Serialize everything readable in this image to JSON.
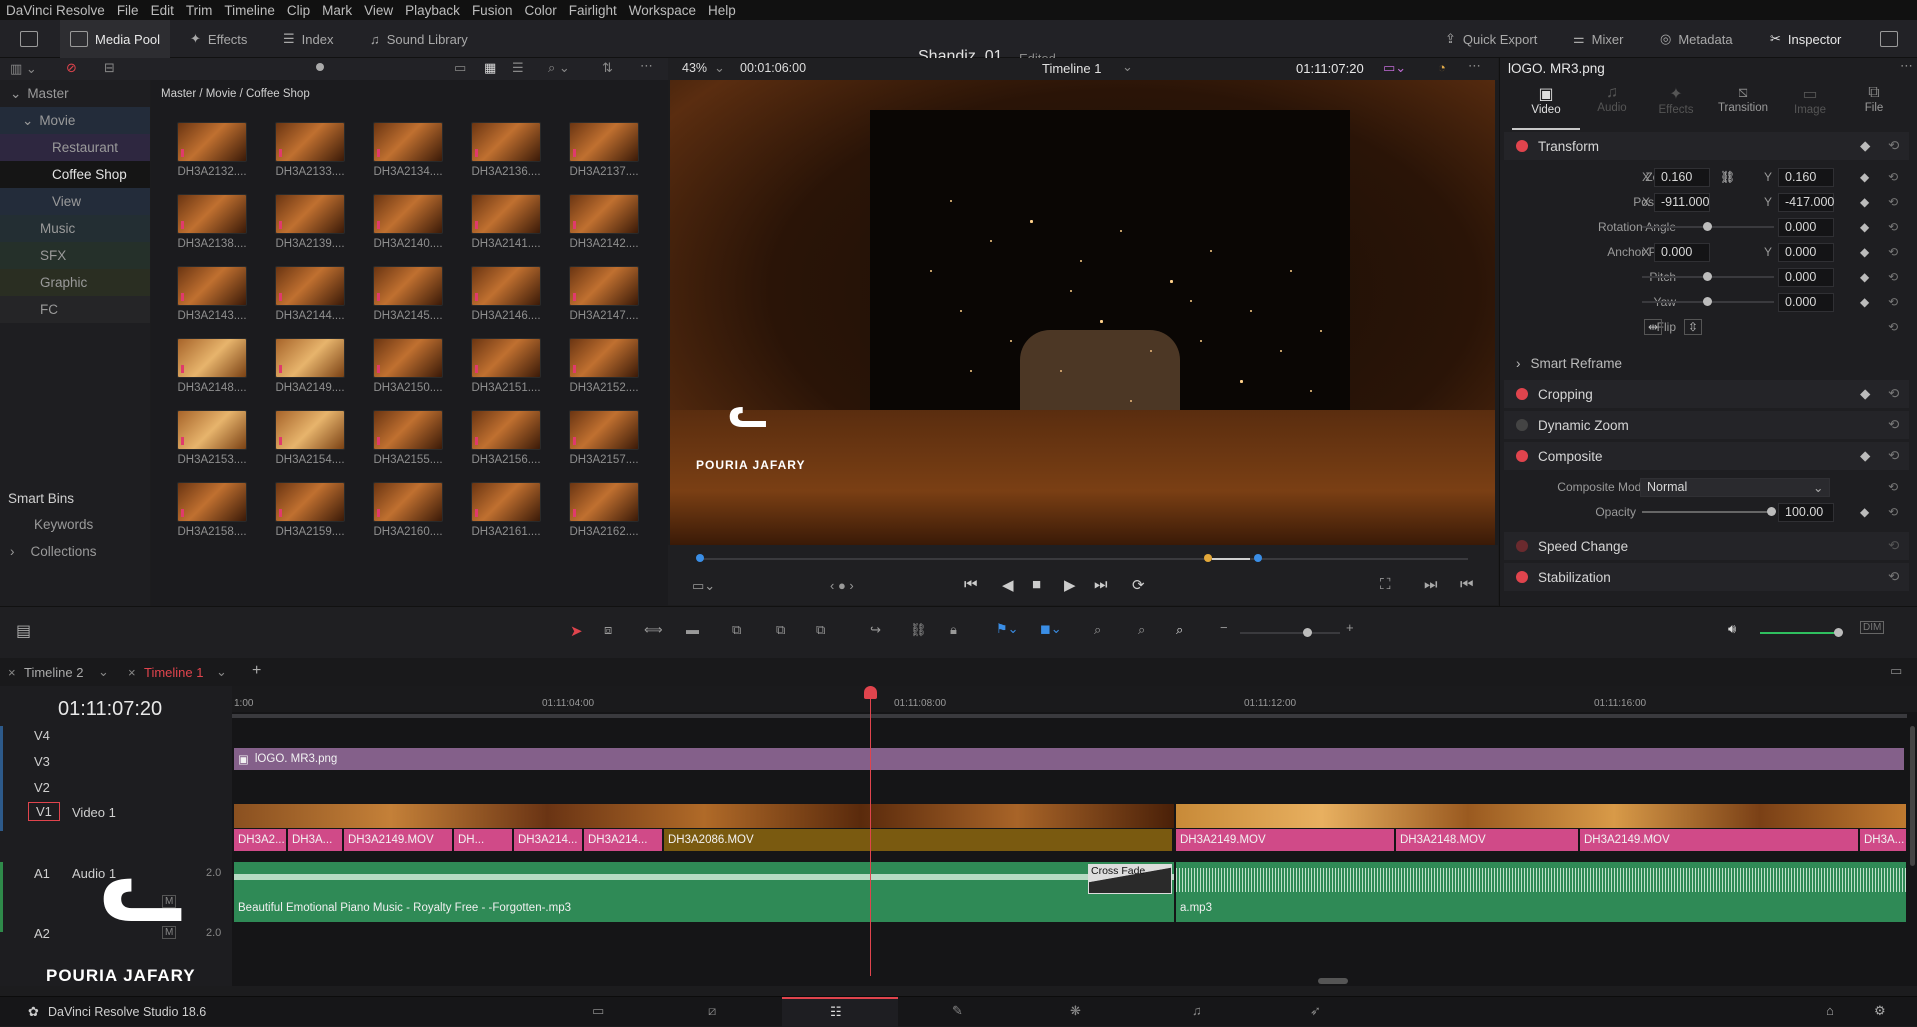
{
  "menu": [
    "DaVinci Resolve",
    "File",
    "Edit",
    "Trim",
    "Timeline",
    "Clip",
    "Mark",
    "View",
    "Playback",
    "Fusion",
    "Color",
    "Fairlight",
    "Workspace",
    "Help"
  ],
  "toolbar": {
    "media_pool": "Media Pool",
    "effects": "Effects",
    "index": "Index",
    "sound_library": "Sound Library",
    "quick_export": "Quick Export",
    "mixer": "Mixer",
    "metadata": "Metadata",
    "inspector": "Inspector"
  },
  "project": {
    "title": "Shandiz_01",
    "status": "Edited"
  },
  "bins": {
    "master": "Master",
    "items": [
      "Movie",
      "Restaurant",
      "Coffee Shop",
      "View",
      "Music",
      "SFX",
      "Graphic",
      "FC"
    ],
    "smart_bins": "Smart Bins",
    "smart_items": [
      "Keywords",
      "Collections"
    ]
  },
  "pool": {
    "path": "Master / Movie / Coffee Shop",
    "clips": [
      "DH3A2132....",
      "DH3A2133....",
      "DH3A2134....",
      "DH3A2136....",
      "DH3A2137....",
      "DH3A2138....",
      "DH3A2139....",
      "DH3A2140....",
      "DH3A2141....",
      "DH3A2142....",
      "DH3A2143....",
      "DH3A2144....",
      "DH3A2145....",
      "DH3A2146....",
      "DH3A2147....",
      "DH3A2148....",
      "DH3A2149....",
      "DH3A2150....",
      "DH3A2151....",
      "DH3A2152....",
      "DH3A2153....",
      "DH3A2154....",
      "DH3A2155....",
      "DH3A2156....",
      "DH3A2157....",
      "DH3A2158....",
      "DH3A2159....",
      "DH3A2160....",
      "DH3A2161....",
      "DH3A2162...."
    ]
  },
  "viewer": {
    "zoom": "43%",
    "duration": "00:01:06:00",
    "timeline": "Timeline 1",
    "timecode": "01:11:07:20"
  },
  "watermark": "POURIA JAFARY",
  "inspector": {
    "clip_name": "lOGO. MR3.png",
    "tabs": [
      "Video",
      "Audio",
      "Effects",
      "Transition",
      "Image",
      "File"
    ],
    "transform": "Transform",
    "zoom": {
      "label": "Zoom",
      "x": "0.160",
      "y": "0.160"
    },
    "position": {
      "label": "Position",
      "x": "-911.000",
      "y": "-417.000"
    },
    "rotation": {
      "label": "Rotation Angle",
      "value": "0.000"
    },
    "anchor": {
      "label": "Anchor Point",
      "x": "0.000",
      "y": "0.000"
    },
    "pitch": {
      "label": "Pitch",
      "value": "0.000"
    },
    "yaw": {
      "label": "Yaw",
      "value": "0.000"
    },
    "flip": "Flip",
    "smart_reframe": "Smart Reframe",
    "cropping": "Cropping",
    "dynamic_zoom": "Dynamic Zoom",
    "composite": "Composite",
    "composite_mode": {
      "label": "Composite Mode",
      "value": "Normal"
    },
    "opacity": {
      "label": "Opacity",
      "value": "100.00"
    },
    "speed_change": "Speed Change",
    "stabilization": "Stabilization",
    "xy": {
      "x": "X",
      "y": "Y"
    }
  },
  "timeline": {
    "tabs": [
      "Timeline 2",
      "Timeline 1"
    ],
    "timecode": "01:11:07:20",
    "ruler": [
      "1:00",
      "01:11:04:00",
      "01:11:08:00",
      "01:11:12:00",
      "01:11:16:00"
    ],
    "tracks": {
      "v4": "V4",
      "v3": "V3",
      "v2": "V2",
      "v1": "V1",
      "video1": "Video 1",
      "a1": "A1",
      "audio1": "Audio 1",
      "a2": "A2",
      "a1_level": "2.0",
      "a2_level": "2.0",
      "m": "M"
    },
    "v3_clip": "lOGO. MR3.png",
    "v1_clips": [
      "DH3A2...",
      "DH3A...",
      "DH3A2149.MOV",
      "DH...",
      "DH3A214...",
      "DH3A214...",
      "DH3A2086.MOV",
      "DH3A2149.MOV",
      "DH3A2148.MOV",
      "DH3A2149.MOV",
      "DH3A..."
    ],
    "audio_clip1": "Beautiful Emotional Piano Music - Royalty Free - -Forgotten-.mp3",
    "audio_clip2": "a.mp3",
    "cross_fade": "Cross Fade"
  },
  "status": {
    "app": "DaVinci Resolve Studio 18.6"
  }
}
